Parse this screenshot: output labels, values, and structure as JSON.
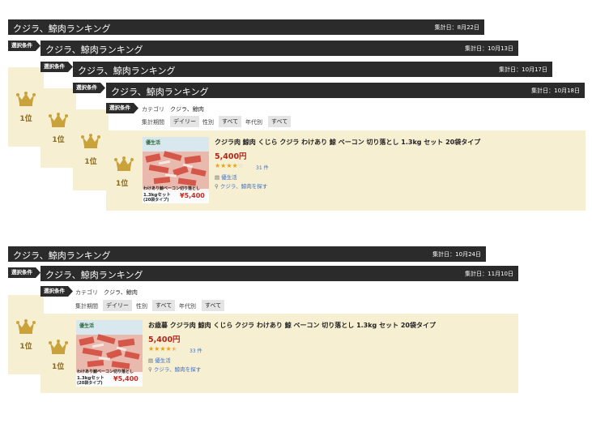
{
  "groups": [
    {
      "bars": [
        {
          "title": "クジラ、鯨肉ランキング",
          "date": "集計日：8月22日"
        },
        {
          "title": "クジラ、鯨肉ランキング",
          "date": "集計日：10月13日"
        },
        {
          "title": "クジラ、鯨肉ランキング",
          "date": "集計日：10月17日"
        },
        {
          "title": "クジラ、鯨肉ランキング",
          "date": "集計日：10月18日"
        }
      ],
      "tag_label": "選択条件",
      "rank_label": "1位",
      "filters": {
        "category_label": "カテゴリ",
        "category_value": "クジラ、鯨肉",
        "period_label": "集計期間",
        "period_value": "デイリー",
        "gender_label": "性別",
        "gender_value": "すべて",
        "age_label": "年代別",
        "age_value": "すべて"
      },
      "product": {
        "name": "クジラ肉 鯨肉 くじら クジラ わけあり 鯨 ベーコン 切り落とし 1.3kg セット 20袋タイプ",
        "price": "5,400円",
        "rating": 4.0,
        "review_count": "31 件",
        "shop": "優生活",
        "search_link": "クジラ、鯨肉を探す",
        "thumb_brand": "優生活",
        "thumb_line1": "わけあり鯨ベーコン切り落とし",
        "thumb_line2": "1.3kgセット",
        "thumb_line3": "(20袋タイプ)",
        "thumb_price": "¥5,400"
      }
    },
    {
      "bars": [
        {
          "title": "クジラ、鯨肉ランキング",
          "date": "集計日：10月24日"
        },
        {
          "title": "クジラ、鯨肉ランキング",
          "date": "集計日：11月10日"
        }
      ],
      "tag_label": "選択条件",
      "rank_label": "1位",
      "filters": {
        "category_label": "カテゴリ",
        "category_value": "クジラ、鯨肉",
        "period_label": "集計期間",
        "period_value": "デイリー",
        "gender_label": "性別",
        "gender_value": "すべて",
        "age_label": "年代別",
        "age_value": "すべて"
      },
      "product": {
        "name": "お歳暮 クジラ肉 鯨肉 くじら クジラ わけあり 鯨 ベーコン 切り落とし 1.3kg セット 20袋タイプ",
        "price": "5,400円",
        "rating": 4.5,
        "review_count": "33 件",
        "shop": "優生活",
        "search_link": "クジラ、鯨肉を探す",
        "thumb_brand": "優生活",
        "thumb_line1": "わけあり鯨ベーコン切り落とし",
        "thumb_line2": "1.3kgセット",
        "thumb_line3": "(20袋タイプ)",
        "thumb_price": "¥5,400"
      }
    }
  ],
  "colors": {
    "bar": "#2b2b2b",
    "rank_bg": "#f7efd2",
    "crown": "#c9a23c",
    "price": "#b5251b",
    "star": "#e8a312",
    "link": "#3b6fc4"
  }
}
